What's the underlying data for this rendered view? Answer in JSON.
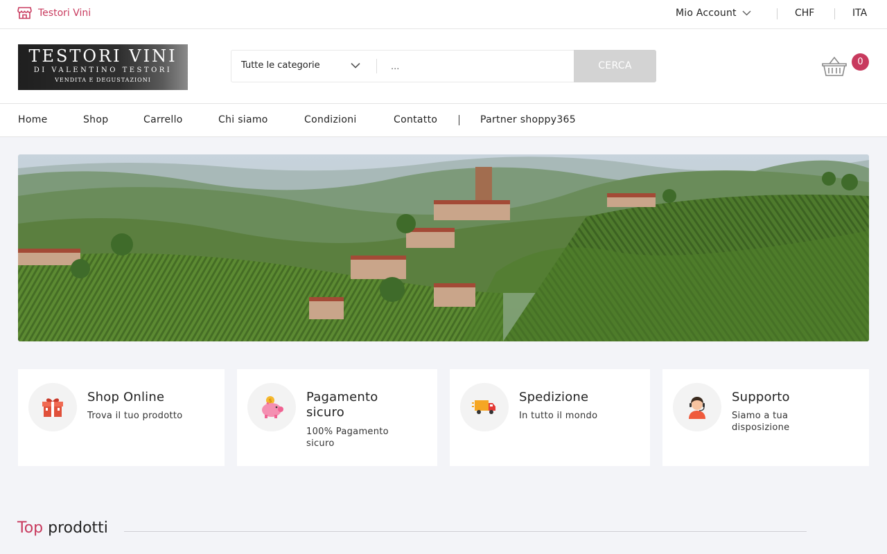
{
  "topbar": {
    "store_name": "Testori Vini",
    "account_label": "Mio Account",
    "currency": "CHF",
    "language": "ITA"
  },
  "header": {
    "logo": {
      "line1": "TESTORI VINI",
      "line2": "DI VALENTINO TESTORI",
      "line3": "VENDITA E DEGUSTAZIONI"
    },
    "search": {
      "category_selected": "Tutte le categorie",
      "placeholder": "...",
      "button_label": "CERCA"
    },
    "cart_count": "0"
  },
  "nav": {
    "items": [
      "Home",
      "Shop",
      "Carrello",
      "Chi siamo",
      "Condizioni",
      "Contatto",
      "Partner shoppy365"
    ]
  },
  "features": [
    {
      "title": "Shop Online",
      "subtitle": "Trova il tuo prodotto",
      "icon": "gift-icon"
    },
    {
      "title": "Pagamento sicuro",
      "subtitle": "100% Pagamento sicuro",
      "icon": "piggy-bank-icon"
    },
    {
      "title": "Spedizione",
      "subtitle": "In tutto il mondo",
      "icon": "delivery-truck-icon"
    },
    {
      "title": "Supporto",
      "subtitle": "Siamo a tua disposizione",
      "icon": "support-agent-icon"
    }
  ],
  "section": {
    "title_accent": "Top",
    "title_rest": "prodotti"
  },
  "colors": {
    "accent": "#c83a5e",
    "button_disabled": "#d3d3d3",
    "page_bg": "#f3f4f8"
  }
}
